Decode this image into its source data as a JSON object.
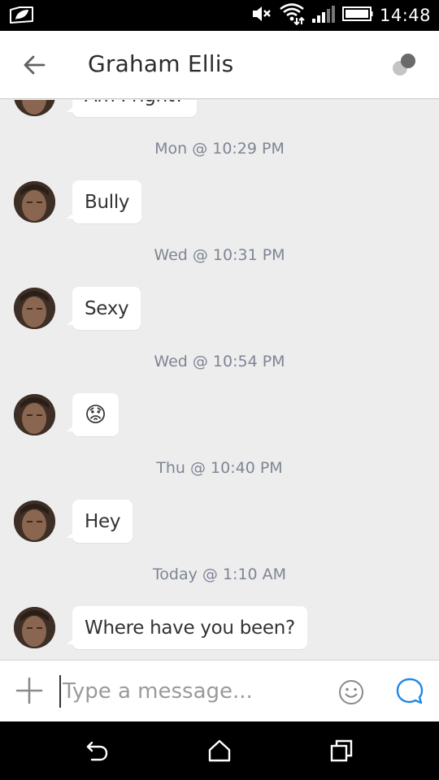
{
  "status_bar": {
    "time": "14:48",
    "icons": [
      "leaf-notification-icon",
      "mute-icon",
      "wifi-icon",
      "signal-icon",
      "battery-icon"
    ]
  },
  "header": {
    "contact_name": "Graham Ellis",
    "back_icon": "arrow-left-icon",
    "presence_icon": "presence-dots-icon"
  },
  "conversation": {
    "partial_top_message": "Am I right?",
    "items": [
      {
        "timestamp": "Mon @ 10:29 PM",
        "message": "Bully"
      },
      {
        "timestamp": "Wed @ 10:31 PM",
        "message": "Sexy"
      },
      {
        "timestamp": "Wed @ 10:54 PM",
        "message": "😟"
      },
      {
        "timestamp": "Thu @ 10:40 PM",
        "message": "Hey"
      },
      {
        "timestamp": "Today @ 1:10 AM",
        "message": "Where have you been?"
      }
    ]
  },
  "compose": {
    "placeholder": "Type a message...",
    "value": "",
    "add_icon": "plus-icon",
    "emoji_icon": "smiley-icon",
    "send_icon": "chat-bubble-icon",
    "accent_color": "#1e88e5"
  },
  "nav_bar": {
    "icons": [
      "back-nav-icon",
      "home-icon",
      "recents-icon"
    ]
  }
}
